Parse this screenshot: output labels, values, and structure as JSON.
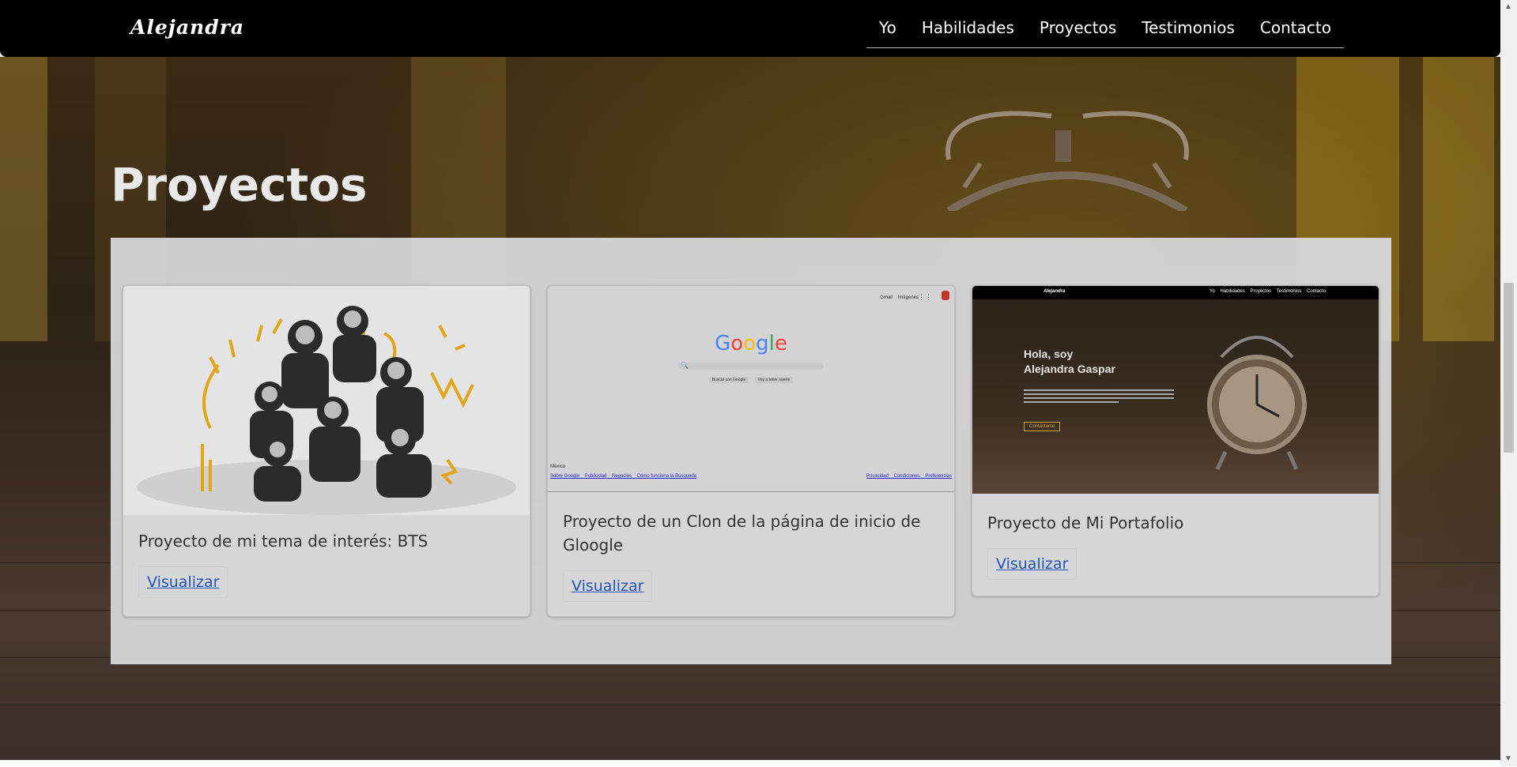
{
  "brand": "Alejandra",
  "nav": [
    "Yo",
    "Habilidades",
    "Proyectos",
    "Testimonios",
    "Contacto"
  ],
  "section_title": "Proyectos",
  "cards": [
    {
      "title": "Proyecto de mi tema de interés: BTS",
      "link": "Visualizar"
    },
    {
      "title": "Proyecto de un Clon de la página de inicio de Gloogle",
      "link": "Visualizar"
    },
    {
      "title": "Proyecto de Mi Portafolio",
      "link": "Visualizar"
    }
  ],
  "google_thumb": {
    "logo": "Google",
    "top_links": [
      "Gmail",
      "Imágenes"
    ],
    "buttons": [
      "Buscar con Google",
      "Voy a tener suerte"
    ],
    "country": "México",
    "footer_left": [
      "Sobre Google",
      "Publicidad",
      "Negocios",
      "Cómo funciona la Búsqueda"
    ],
    "footer_right": [
      "Privacidad",
      "Condiciones",
      "Preferencias"
    ]
  },
  "portfolio_thumb": {
    "brand": "Alejandra",
    "nav": [
      "Yo",
      "Habilidades",
      "Proyectos",
      "Testimonios",
      "Contacto"
    ],
    "greeting": "Hola, soy",
    "name": "Alejandra Gaspar",
    "button": "Contactame"
  },
  "colors": {
    "navbar": "#000000",
    "link": "#1f55b8",
    "panel": "#dbdbde"
  }
}
